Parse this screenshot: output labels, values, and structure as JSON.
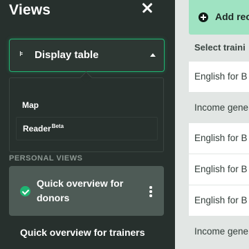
{
  "sidebar": {
    "title": "Views",
    "view_selector": {
      "label": "Display table",
      "icon": "table-icon"
    },
    "dropdown": {
      "map_label": "Map",
      "reader_label": "Reader",
      "reader_badge": "Beta"
    },
    "section_label": "PERSONAL VIEWS",
    "personal_views": [
      {
        "label": "Quick overview for donors",
        "active": true
      },
      {
        "label": "Quick overview for trainers",
        "active": false
      }
    ]
  },
  "main": {
    "add_button_label": "Add rec",
    "column_header": "Select traini",
    "rows": [
      "English for B",
      "Income gene",
      "English for B",
      "English for B",
      "English for B",
      "Income gene"
    ]
  },
  "colors": {
    "accent": "#1fb572",
    "sidebar_bg": "#27302d",
    "add_button_bg": "#9fe3c2"
  }
}
